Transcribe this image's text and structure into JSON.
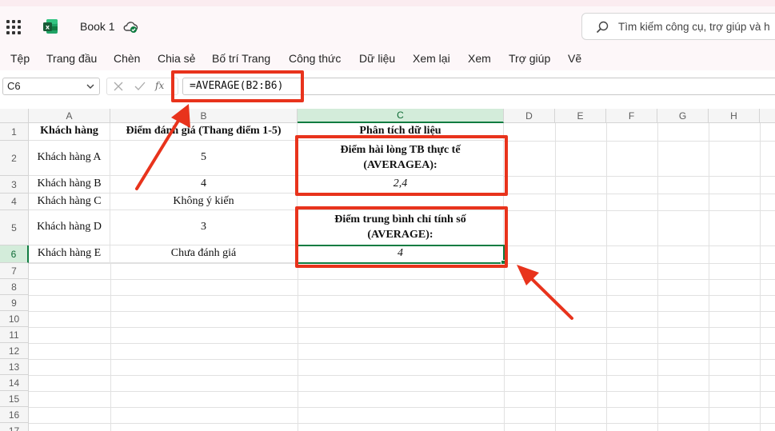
{
  "app": {
    "title": "Book 1",
    "search_placeholder": "Tìm kiếm công cụ, trợ giúp và h",
    "accent": "#107c41"
  },
  "menu": [
    "Tệp",
    "Trang đầu",
    "Chèn",
    "Chia sẻ",
    "Bố trí Trang",
    "Công thức",
    "Dữ liệu",
    "Xem lại",
    "Xem",
    "Trợ giúp",
    "Vẽ"
  ],
  "formula_bar": {
    "name_box": "C6",
    "fx": "fx",
    "formula": "=AVERAGE(B2:B6)"
  },
  "sheet": {
    "columns": [
      "A",
      "B",
      "C",
      "D",
      "E",
      "F",
      "G",
      "H"
    ],
    "rows": [
      "1",
      "2",
      "3",
      "4",
      "5",
      "6",
      "7",
      "8",
      "9",
      "10",
      "11",
      "12",
      "13",
      "14",
      "15",
      "16",
      "17"
    ],
    "cells": {
      "A1": "Khách hàng",
      "B1": "Điểm đánh giá (Thang điểm 1-5)",
      "C1": "Phân tích dữ liệu",
      "A2": "Khách hàng A",
      "B2": "5",
      "C2": "Điểm hài lòng TB thực tế (AVERAGEA):",
      "A3": "Khách hàng B",
      "B3": "4",
      "C3": "2,4",
      "A4": "Khách hàng C",
      "B4": "Không ý kiến",
      "A5": "Khách hàng D",
      "B5": "3",
      "C5": "Điểm trung bình chỉ tính số (AVERAGE):",
      "A6": "Khách hàng E",
      "B6": "Chưa đánh giá",
      "C6": "4"
    },
    "active_cell": "C6"
  },
  "annotation_color": "#e8331c"
}
